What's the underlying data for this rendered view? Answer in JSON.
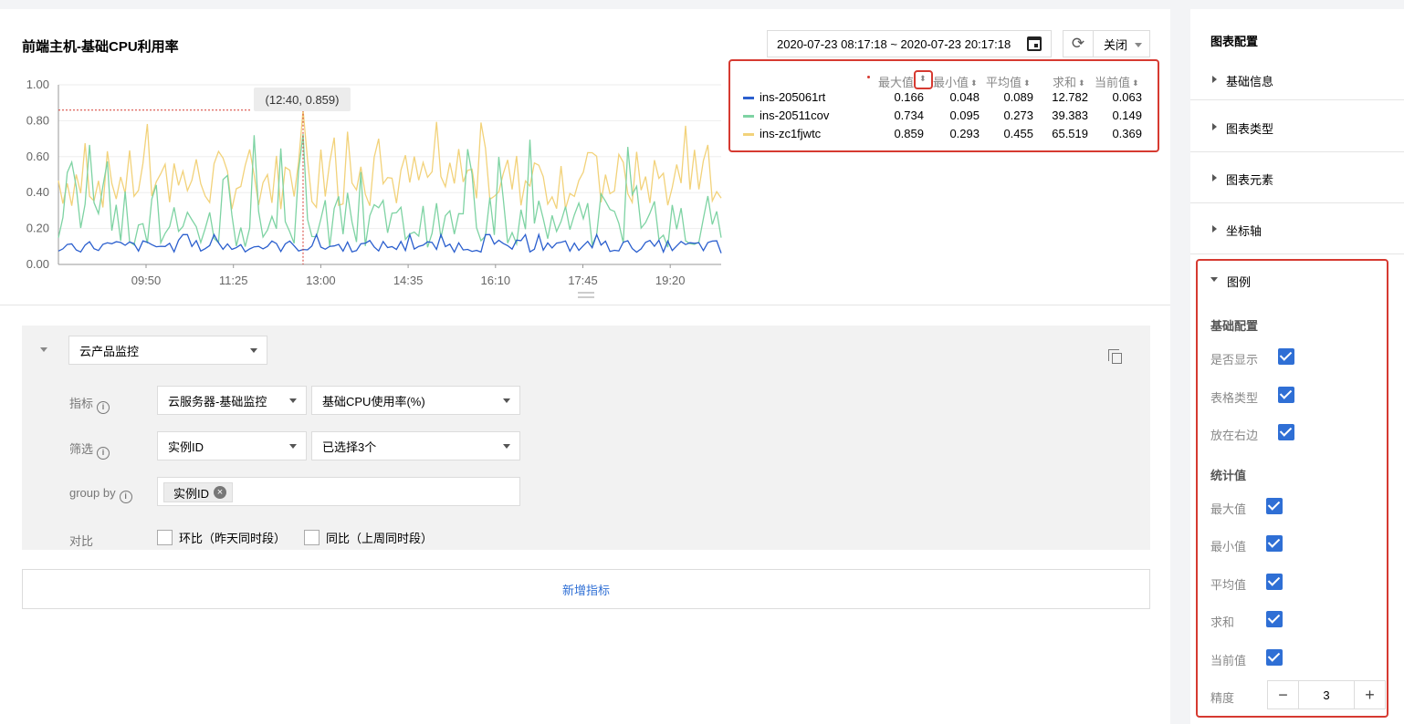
{
  "chart": {
    "title": "前端主机-基础CPU利用率",
    "time_range": "2020-07-23 08:17:18 ~ 2020-07-23 20:17:18",
    "close_label": "关闭",
    "tooltip": "(12:40, 0.859)"
  },
  "legend": {
    "headers": [
      "最大值",
      "最小值",
      "平均值",
      "求和",
      "当前值"
    ],
    "rows": [
      {
        "name": "ins-205061rt",
        "color": "#2b5fce",
        "max": "0.166",
        "min": "0.048",
        "avg": "0.089",
        "sum": "12.782",
        "cur": "0.063"
      },
      {
        "name": "ins-20511cov",
        "color": "#7ed3a3",
        "max": "0.734",
        "min": "0.095",
        "avg": "0.273",
        "sum": "39.383",
        "cur": "0.149"
      },
      {
        "name": "ins-zc1fjwtc",
        "color": "#f2d27a",
        "max": "0.859",
        "min": "0.293",
        "avg": "0.455",
        "sum": "65.519",
        "cur": "0.369"
      }
    ]
  },
  "chart_data": {
    "type": "line",
    "title": "前端主机-基础CPU利用率",
    "xlabel": "",
    "ylabel": "",
    "ylim": [
      0,
      1
    ],
    "y_ticks": [
      "1.00",
      "0.80",
      "0.60",
      "0.40",
      "0.20",
      "0.00"
    ],
    "x_ticks": [
      "09:50",
      "11:25",
      "13:00",
      "14:35",
      "16:10",
      "17:45",
      "19:20"
    ],
    "highlight": {
      "x": "12:40",
      "y": 0.859
    },
    "series": [
      {
        "name": "ins-205061rt",
        "color": "#2b5fce",
        "max": 0.166,
        "min": 0.048,
        "avg": 0.089,
        "current": 0.063
      },
      {
        "name": "ins-20511cov",
        "color": "#7ed3a3",
        "max": 0.734,
        "min": 0.095,
        "avg": 0.273,
        "current": 0.149
      },
      {
        "name": "ins-zc1fjwtc",
        "color": "#f2d27a",
        "max": 0.859,
        "min": 0.293,
        "avg": 0.455,
        "current": 0.369
      }
    ]
  },
  "query": {
    "product": "云产品监控",
    "metric_label": "指标",
    "metric_service": "云服务器-基础监控",
    "metric_name": "基础CPU使用率(%)",
    "filter_label": "筛选",
    "filter_field": "实例ID",
    "filter_value": "已选择3个",
    "groupby_label": "group by",
    "groupby_tag": "实例ID",
    "compare_label": "对比",
    "compare_dod": "环比（昨天同时段）",
    "compare_wow": "同比（上周同时段）",
    "add_metric": "新增指标"
  },
  "sidebar": {
    "title": "图表配置",
    "items": [
      "基础信息",
      "图表类型",
      "图表元素",
      "坐标轴"
    ],
    "legend_section": {
      "title": "图例",
      "basic_title": "基础配置",
      "basic_options": [
        "是否显示",
        "表格类型",
        "放在右边"
      ],
      "stats_title": "统计值",
      "stats_options": [
        "最大值",
        "最小值",
        "平均值",
        "求和",
        "当前值"
      ],
      "precision_label": "精度",
      "precision_value": "3"
    }
  }
}
